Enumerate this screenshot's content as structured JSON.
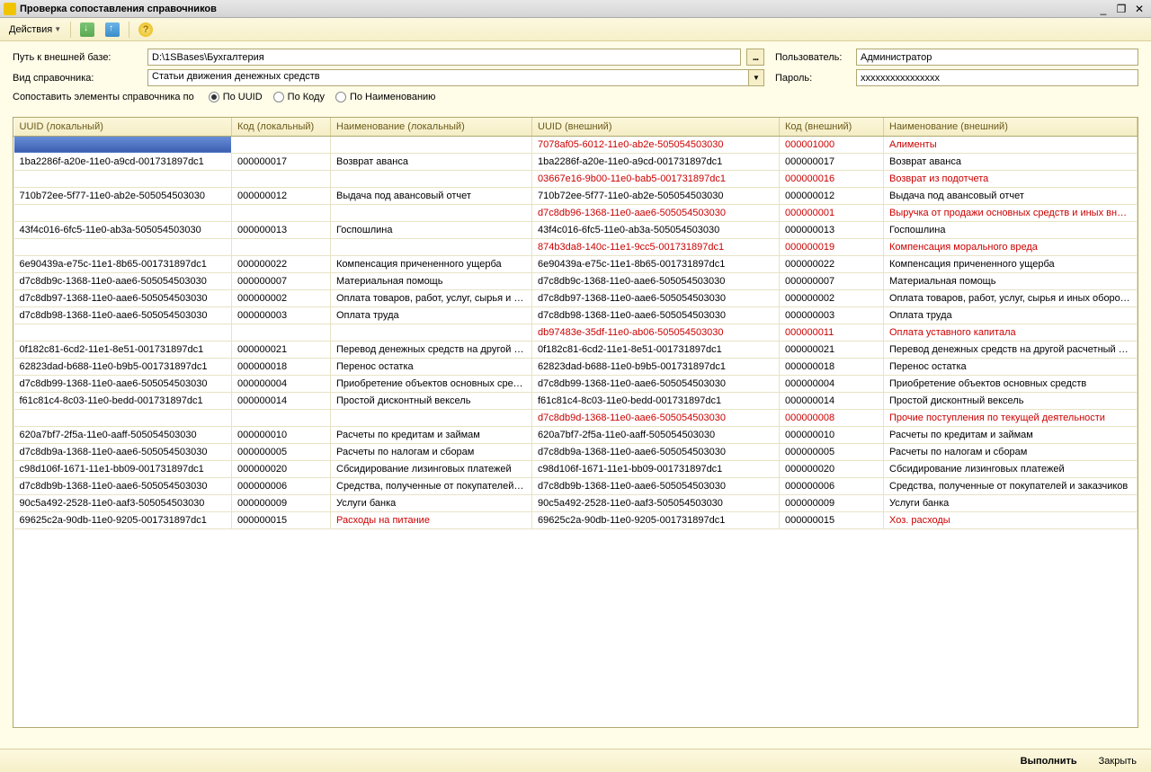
{
  "window": {
    "title": "Проверка сопоставления справочников",
    "minimize": "_",
    "maximize": "❐",
    "close": "✕"
  },
  "toolbar": {
    "actions_label": "Действия"
  },
  "form": {
    "path_label": "Путь к внешней базе:",
    "path_value": "D:\\1SBases\\Бухгалтерия",
    "browse": "...",
    "user_label": "Пользователь:",
    "user_value": "Администратор",
    "type_label": "Вид справочника:",
    "type_value": "Статьи движения денежных средств",
    "password_label": "Пароль:",
    "password_value": "xxxxxxxxxxxxxxxx",
    "match_label": "Сопоставить элементы справочника по",
    "radio_uuid": "По UUID",
    "radio_code": "По Коду",
    "radio_name": "По Наименованию"
  },
  "table": {
    "headers": {
      "uuid_local": "UUID (локальный)",
      "code_local": "Код (локальный)",
      "name_local": "Наименование (локальный)",
      "uuid_ext": "UUID (внешний)",
      "code_ext": "Код (внешний)",
      "name_ext": "Наименование (внешний)"
    },
    "rows": [
      {
        "ul": "",
        "cl": "",
        "nl": "",
        "ue": "7078af05-6012-11e0-ab2e-505054503030",
        "ce": "000001000",
        "ne": "Алименты",
        "mismatch": true,
        "sel": true
      },
      {
        "ul": "1ba2286f-a20e-11e0-a9cd-001731897dc1",
        "cl": "000000017",
        "nl": "Возврат аванса",
        "ue": "1ba2286f-a20e-11e0-a9cd-001731897dc1",
        "ce": "000000017",
        "ne": "Возврат аванса"
      },
      {
        "ul": "",
        "cl": "",
        "nl": "",
        "ue": "03667e16-9b00-11e0-bab5-001731897dc1",
        "ce": "000000016",
        "ne": "Возврат из подотчета",
        "mismatch": true
      },
      {
        "ul": "710b72ee-5f77-11e0-ab2e-505054503030",
        "cl": "000000012",
        "nl": "Выдача под авансовый отчет",
        "ue": "710b72ee-5f77-11e0-ab2e-505054503030",
        "ce": "000000012",
        "ne": "Выдача под авансовый отчет"
      },
      {
        "ul": "",
        "cl": "",
        "nl": "",
        "ue": "d7c8db96-1368-11e0-aae6-505054503030",
        "ce": "000000001",
        "ne": "Выручка от продажи основных средств и иных внео...",
        "mismatch": true
      },
      {
        "ul": "43f4c016-6fc5-11e0-ab3a-505054503030",
        "cl": "000000013",
        "nl": "Госпошлина",
        "ue": "43f4c016-6fc5-11e0-ab3a-505054503030",
        "ce": "000000013",
        "ne": "Госпошлина"
      },
      {
        "ul": "",
        "cl": "",
        "nl": "",
        "ue": "874b3da8-140c-11e1-9cc5-001731897dc1",
        "ce": "000000019",
        "ne": "Компенсация морального вреда",
        "mismatch": true
      },
      {
        "ul": "6e90439a-e75c-11e1-8b65-001731897dc1",
        "cl": "000000022",
        "nl": "Компенсация причененного ущерба",
        "ue": "6e90439a-e75c-11e1-8b65-001731897dc1",
        "ce": "000000022",
        "ne": "Компенсация причененного ущерба"
      },
      {
        "ul": "d7c8db9c-1368-11e0-aae6-505054503030",
        "cl": "000000007",
        "nl": "Материальная помощь",
        "ue": "d7c8db9c-1368-11e0-aae6-505054503030",
        "ce": "000000007",
        "ne": "Материальная помощь"
      },
      {
        "ul": "d7c8db97-1368-11e0-aae6-505054503030",
        "cl": "000000002",
        "nl": "Оплата товаров, работ, услуг, сырья и и...",
        "ue": "d7c8db97-1368-11e0-aae6-505054503030",
        "ce": "000000002",
        "ne": "Оплата товаров, работ, услуг, сырья и иных оборот..."
      },
      {
        "ul": "d7c8db98-1368-11e0-aae6-505054503030",
        "cl": "000000003",
        "nl": "Оплата труда",
        "ue": "d7c8db98-1368-11e0-aae6-505054503030",
        "ce": "000000003",
        "ne": "Оплата труда"
      },
      {
        "ul": "",
        "cl": "",
        "nl": "",
        "ue": "db97483e-35df-11e0-ab06-505054503030",
        "ce": "000000011",
        "ne": "Оплата уставного капитала",
        "mismatch": true
      },
      {
        "ul": "0f182c81-6cd2-11e1-8e51-001731897dc1",
        "cl": "000000021",
        "nl": "Перевод денежных средств на другой р...",
        "ue": "0f182c81-6cd2-11e1-8e51-001731897dc1",
        "ce": "000000021",
        "ne": "Перевод денежных средств на другой расчетный сч..."
      },
      {
        "ul": "62823dad-b688-11e0-b9b5-001731897dc1",
        "cl": "000000018",
        "nl": "Перенос остатка",
        "ue": "62823dad-b688-11e0-b9b5-001731897dc1",
        "ce": "000000018",
        "ne": "Перенос остатка"
      },
      {
        "ul": "d7c8db99-1368-11e0-aae6-505054503030",
        "cl": "000000004",
        "nl": "Приобретение объектов основных сред...",
        "ue": "d7c8db99-1368-11e0-aae6-505054503030",
        "ce": "000000004",
        "ne": "Приобретение объектов основных средств"
      },
      {
        "ul": "f61c81c4-8c03-11e0-bedd-001731897dc1",
        "cl": "000000014",
        "nl": "Простой дисконтный вексель",
        "ue": "f61c81c4-8c03-11e0-bedd-001731897dc1",
        "ce": "000000014",
        "ne": "Простой дисконтный вексель"
      },
      {
        "ul": "",
        "cl": "",
        "nl": "",
        "ue": "d7c8db9d-1368-11e0-aae6-505054503030",
        "ce": "000000008",
        "ne": "Прочие поступления по текущей деятельности",
        "mismatch": true
      },
      {
        "ul": "620a7bf7-2f5a-11e0-aaff-505054503030",
        "cl": "000000010",
        "nl": "Расчеты по кредитам и займам",
        "ue": "620a7bf7-2f5a-11e0-aaff-505054503030",
        "ce": "000000010",
        "ne": "Расчеты по кредитам и займам"
      },
      {
        "ul": "d7c8db9a-1368-11e0-aae6-505054503030",
        "cl": "000000005",
        "nl": "Расчеты по налогам и сборам",
        "ue": "d7c8db9a-1368-11e0-aae6-505054503030",
        "ce": "000000005",
        "ne": "Расчеты по налогам и сборам"
      },
      {
        "ul": "c98d106f-1671-11e1-bb09-001731897dc1",
        "cl": "000000020",
        "nl": "Сбсидирование лизинговых платежей",
        "ue": "c98d106f-1671-11e1-bb09-001731897dc1",
        "ce": "000000020",
        "ne": "Сбсидирование лизинговых платежей"
      },
      {
        "ul": "d7c8db9b-1368-11e0-aae6-505054503030",
        "cl": "000000006",
        "nl": "Средства, полученные от покупателей и ...",
        "ue": "d7c8db9b-1368-11e0-aae6-505054503030",
        "ce": "000000006",
        "ne": "Средства, полученные от покупателей и заказчиков"
      },
      {
        "ul": "90c5a492-2528-11e0-aaf3-505054503030",
        "cl": "000000009",
        "nl": "Услуги банка",
        "ue": "90c5a492-2528-11e0-aaf3-505054503030",
        "ce": "000000009",
        "ne": "Услуги банка"
      },
      {
        "ul": "69625c2a-90db-11e0-9205-001731897dc1",
        "cl": "000000015",
        "nl": "Расходы на питание",
        "ue": "69625c2a-90db-11e0-9205-001731897dc1",
        "ce": "000000015",
        "ne": "Хоз. расходы",
        "name_mismatch": true
      }
    ]
  },
  "footer": {
    "execute": "Выполнить",
    "close": "Закрыть"
  }
}
